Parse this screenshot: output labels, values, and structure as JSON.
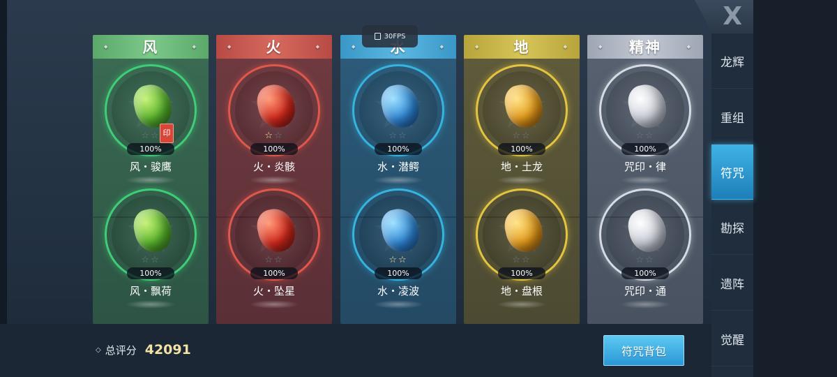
{
  "hud": {
    "fps": "30FPS"
  },
  "close": {
    "label": "X"
  },
  "columns": [
    {
      "title": "风",
      "slots": [
        {
          "name": "风・骏鹰",
          "pct": "100%",
          "lit": 0,
          "badge": "印"
        },
        {
          "name": "风・飘荷",
          "pct": "100%",
          "lit": 0
        }
      ]
    },
    {
      "title": "火",
      "slots": [
        {
          "name": "火・炎骸",
          "pct": "100%",
          "lit": 1
        },
        {
          "name": "火・坠星",
          "pct": "100%",
          "lit": 0
        }
      ]
    },
    {
      "title": "水",
      "slots": [
        {
          "name": "水・潜鳄",
          "pct": "100%",
          "lit": 0
        },
        {
          "name": "水・凌波",
          "pct": "100%",
          "lit": 2
        }
      ]
    },
    {
      "title": "地",
      "slots": [
        {
          "name": "地・土龙",
          "pct": "100%",
          "lit": 0
        },
        {
          "name": "地・盘根",
          "pct": "100%",
          "lit": 0
        }
      ]
    },
    {
      "title": "精神",
      "slots": [
        {
          "name": "咒印・律",
          "pct": "100%",
          "lit": 0
        },
        {
          "name": "咒印・通",
          "pct": "100%",
          "lit": 0
        }
      ]
    }
  ],
  "sidebar": {
    "items": [
      {
        "label": "龙辉"
      },
      {
        "label": "重组"
      },
      {
        "label": "符咒"
      },
      {
        "label": "勘探"
      },
      {
        "label": "遗阵"
      },
      {
        "label": "觉醒"
      }
    ],
    "active": "符咒"
  },
  "footer": {
    "score_label": "总评分",
    "score_value": "42091",
    "bag_button": "符咒背包"
  },
  "colors": {
    "wind": "#4fae5d",
    "fire": "#c9463f",
    "water": "#3aa7d8",
    "earth": "#c9b13a",
    "spirit": "#b9bfcc",
    "active_tab": "#3fb3e6",
    "score": "#f2e2a4"
  }
}
